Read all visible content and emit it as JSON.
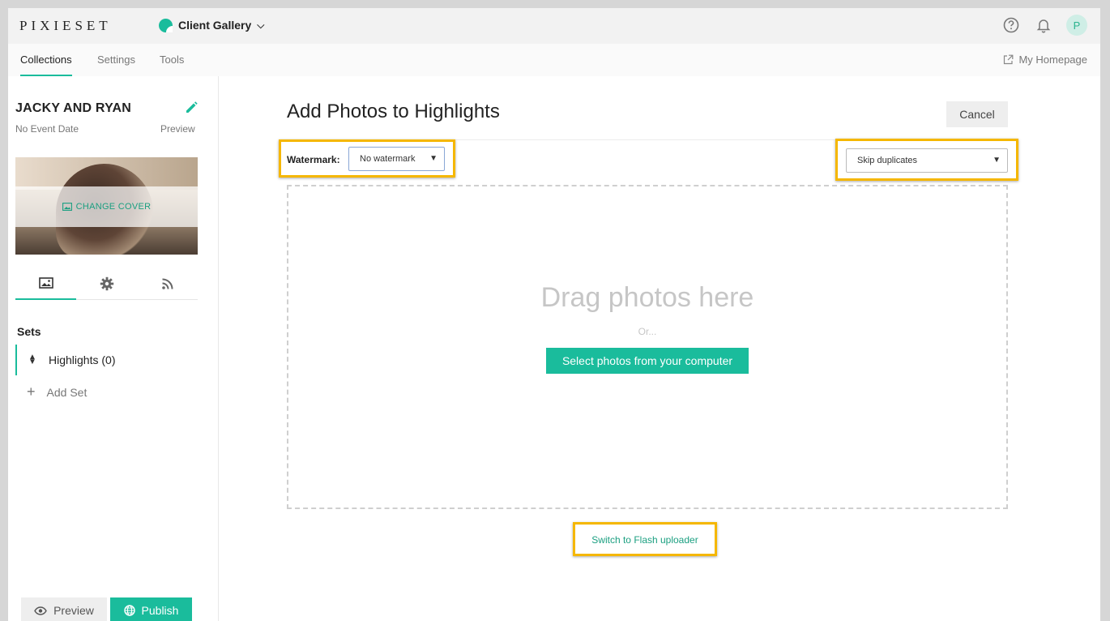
{
  "topbar": {
    "logo": "PIXIESET",
    "app_switcher": "Client Gallery",
    "icons": [
      "help-icon",
      "bell-icon"
    ],
    "avatar_letter": "P"
  },
  "nav": {
    "tabs": [
      {
        "label": "Collections",
        "active": true
      },
      {
        "label": "Settings",
        "active": false
      },
      {
        "label": "Tools",
        "active": false
      }
    ],
    "my_homepage": "My Homepage"
  },
  "sidebar": {
    "collection_name": "JACKY AND RYAN",
    "event_date": "No Event Date",
    "preview_link": "Preview",
    "change_cover": "CHANGE COVER",
    "tabs": [
      "photos-icon",
      "gear-icon",
      "rss-icon"
    ],
    "sets_label": "Sets",
    "sets": [
      {
        "label": "Highlights (0)"
      }
    ],
    "add_set": "Add Set",
    "preview_button": "Preview",
    "publish_button": "Publish"
  },
  "main": {
    "title": "Add Photos to Highlights",
    "cancel": "Cancel",
    "watermark_label": "Watermark:",
    "watermark_value": "No watermark",
    "duplicates_value": "Skip duplicates",
    "drag_text": "Drag photos here",
    "or_text": "Or...",
    "select_button": "Select photos from your computer",
    "flash_link": "Switch to Flash uploader"
  },
  "colors": {
    "accent": "#1abc9c",
    "highlight_border": "#f5b700"
  }
}
